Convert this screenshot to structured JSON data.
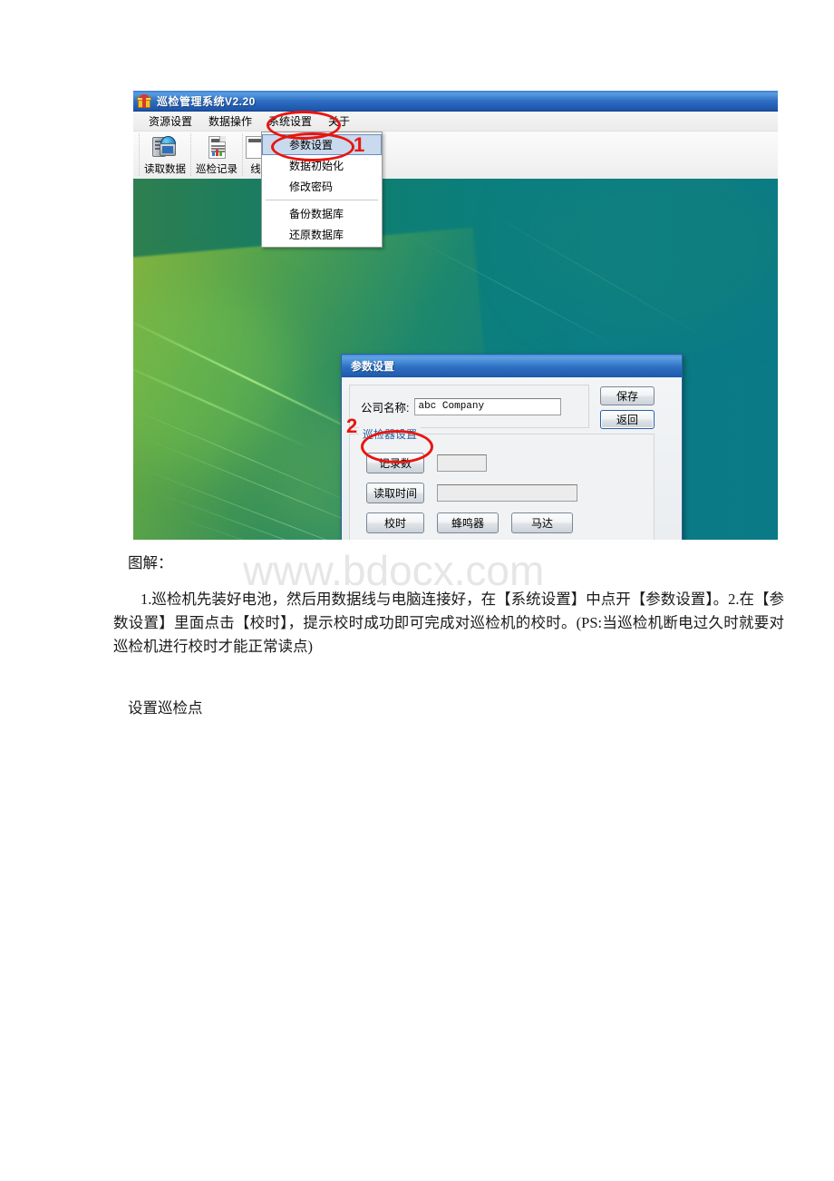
{
  "document": {
    "watermark": "www.bdocx.com",
    "caption_label": "图解：",
    "instructions": "1.巡检机先装好电池，然后用数据线与电脑连接好，在【系统设置】中点开【参数设置】。2.在【参数设置】里面点击【校时】，提示校时成功即可完成对巡检机的校时。(PS:当巡检机断电过久时就要对巡检机进行校时才能正常读点)",
    "section_heading": "设置巡检点"
  },
  "app": {
    "title": "巡检管理系统V2.20",
    "title_icon": "gift-box-icon",
    "menubar": [
      {
        "label": "资源设置"
      },
      {
        "label": "数据操作"
      },
      {
        "label": "系统设置"
      },
      {
        "label": "关于"
      }
    ],
    "toolbar": [
      {
        "label": "读取数据",
        "icon": "server-globe-icon"
      },
      {
        "label": "巡检记录",
        "icon": "report-document-icon"
      },
      {
        "label": "线",
        "icon": "route-icon"
      }
    ],
    "dropdown": {
      "owner": "系统设置",
      "items": [
        {
          "label": "参数设置",
          "selected": true
        },
        {
          "label": "数据初始化",
          "selected": false
        },
        {
          "label": "修改密码",
          "selected": false
        },
        {
          "label": "---separator---",
          "selected": false
        },
        {
          "label": "备份数据库",
          "selected": false
        },
        {
          "label": "还原数据库",
          "selected": false
        }
      ]
    }
  },
  "dialog": {
    "title": "参数设置",
    "company_label": "公司名称:",
    "company_value": "abc Company",
    "save_label": "保存",
    "back_label": "返回",
    "group_title": "巡检器设置",
    "record_count_label": "记录数",
    "record_count_value": "",
    "read_time_label": "读取时间",
    "read_time_value": "",
    "sync_time_label": "校时",
    "buzzer_label": "蜂鸣器",
    "motor_label": "马达"
  },
  "annotations": [
    {
      "number": "1",
      "target": "参数设置"
    },
    {
      "number": "2",
      "target": "校时"
    }
  ],
  "colors": {
    "annotation_red": "#e8150f",
    "titlebar_blue": "#2e70c2",
    "wallpaper_teal": "#0a7a87",
    "wallpaper_green": "#96be3c",
    "group_title_blue": "#2a6099",
    "watermark_gray": "#e6e6e6"
  }
}
